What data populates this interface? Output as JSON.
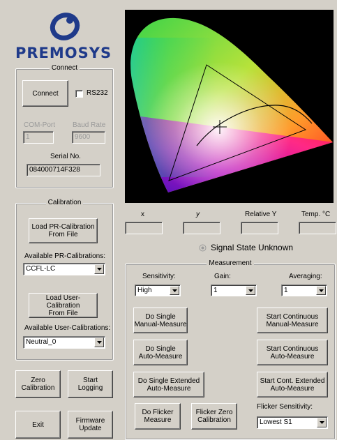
{
  "logo": {
    "text": "PREMOSYS"
  },
  "connect": {
    "title": "Connect",
    "connect_label": "Connect",
    "rs232_label": "RS232",
    "com_port_label": "COM-Port",
    "com_port_value": "1",
    "baud_rate_label": "Baud Rate",
    "baud_rate_value": "9600",
    "serial_label": "Serial No.",
    "serial_value": "084000714F328"
  },
  "calibration": {
    "title": "Calibration",
    "load_pr_label": "Load PR-Calibration\nFrom File",
    "available_pr_label": "Available PR-Calibrations:",
    "pr_selected": "CCFL-LC",
    "load_user_label": "Load User-Calibration\nFrom File",
    "available_user_label": "Available User-Calibrations:",
    "user_selected": "Neutral_0"
  },
  "buttons": {
    "zero_calibration": "Zero\nCalibration",
    "start_logging": "Start\nLogging",
    "exit": "Exit",
    "firmware_update": "Firmware\nUpdate"
  },
  "readouts": {
    "x_label": "x",
    "y_label": "y",
    "relY_label": "Relative Y",
    "temp_label": "Temp. °C",
    "x_value": "",
    "y_value": "",
    "relY_value": "",
    "temp_value": ""
  },
  "signal_state": "Signal State Unknown",
  "measurement": {
    "title": "Measurement",
    "sensitivity_label": "Sensitivity:",
    "sensitivity_value": "High",
    "gain_label": "Gain:",
    "gain_value": "1",
    "averaging_label": "Averaging:",
    "averaging_value": "1",
    "single_manual": "Do Single\nManual-Measure",
    "cont_manual": "Start Continuous\nManual-Measure",
    "single_auto": "Do Single\nAuto-Measure",
    "cont_auto": "Start Continuous\nAuto-Measure",
    "single_ext_auto": "Do Single Extended\nAuto-Measure",
    "cont_ext_auto": "Start Cont. Extended\nAuto-Measure",
    "flicker_measure": "Do Flicker\nMeasure",
    "flicker_zero": "Flicker Zero\nCalibration",
    "flicker_sens_label": "Flicker Sensitivity:",
    "flicker_sens_value": "Lowest S1"
  },
  "colors": {
    "dialog_bg": "#d4d0c8",
    "logo_blue": "#1f3a8a",
    "chart_bg": "#000000"
  }
}
